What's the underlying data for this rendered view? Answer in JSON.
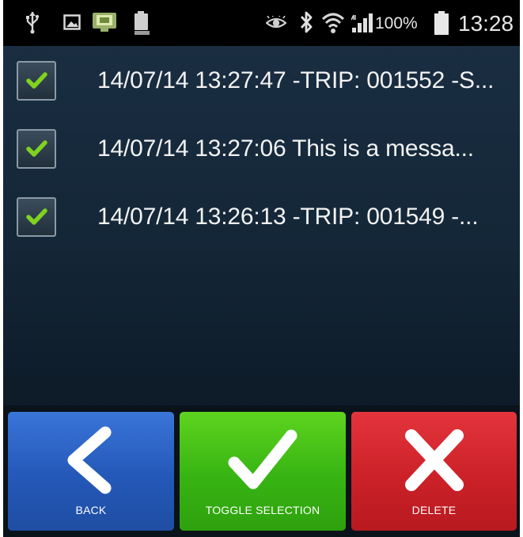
{
  "status_bar": {
    "icons": [
      "usb-icon",
      "image-icon",
      "tv-icon",
      "battery-saver-icon",
      "eye-icon",
      "bluetooth-icon",
      "wifi-icon",
      "signal-icon",
      "battery-icon"
    ],
    "battery_percent": "100%",
    "time": "13:28"
  },
  "messages": [
    {
      "checked": true,
      "text": "14/07/14 13:27:47 -TRIP: 001552 -S..."
    },
    {
      "checked": true,
      "text": "14/07/14 13:27:06 This is a messa..."
    },
    {
      "checked": true,
      "text": "14/07/14 13:26:13 -TRIP: 001549 -..."
    }
  ],
  "actions": {
    "back": {
      "label": "BACK",
      "icon": "chevron-left-icon",
      "color": "#2a5fc2"
    },
    "toggle": {
      "label": "TOGGLE SELECTION",
      "icon": "checkmark-icon",
      "color": "#3cbc14"
    },
    "delete": {
      "label": "DELETE",
      "icon": "x-icon",
      "color": "#d22229"
    }
  },
  "colors": {
    "checkmark": "#7fd320",
    "background": "#142738"
  }
}
